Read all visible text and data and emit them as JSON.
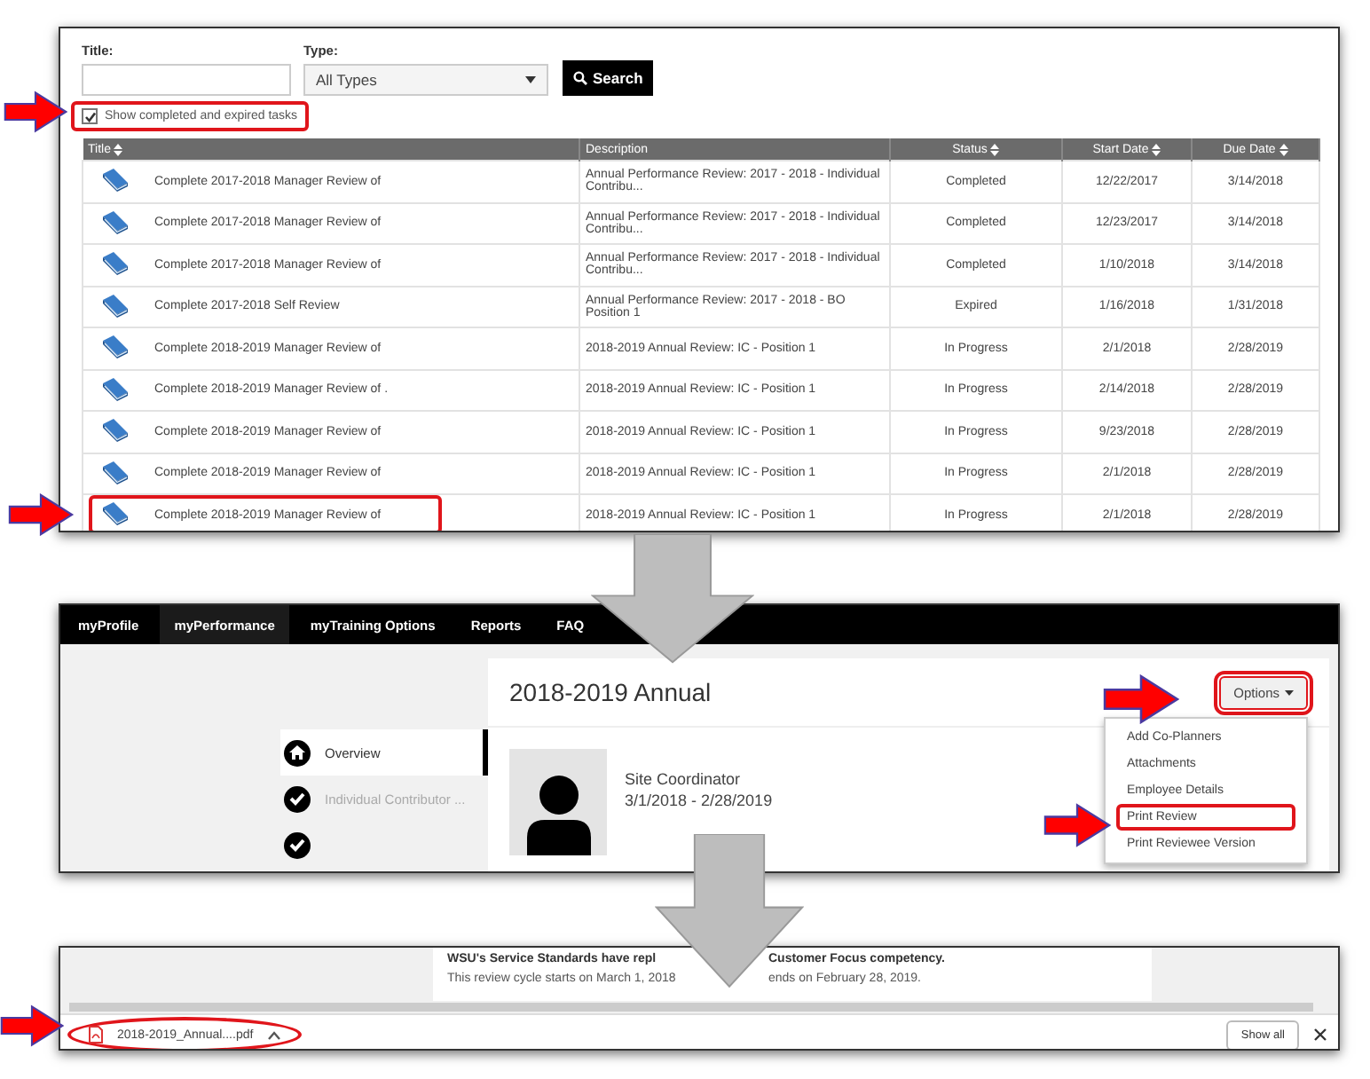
{
  "search_panel": {
    "title_label": "Title:",
    "type_label": "Type:",
    "type_select": {
      "value": "All Types"
    },
    "search_button": "Search",
    "show_completed": {
      "label": "Show completed and expired tasks",
      "checked": true,
      "highlighted": true
    },
    "table": {
      "columns": [
        {
          "label": "Title",
          "sortable": true
        },
        {
          "label": "Description",
          "sortable": false
        },
        {
          "label": "Status",
          "sortable": true
        },
        {
          "label": "Start Date",
          "sortable": true
        },
        {
          "label": "Due Date",
          "sortable": true
        }
      ],
      "rows": [
        {
          "title": "Complete 2017-2018 Manager Review of",
          "description": "Annual Performance Review: 2017 - 2018 - Individual Contribu...",
          "status": "Completed",
          "start_date": "12/22/2017",
          "due_date": "3/14/2018",
          "highlighted": false
        },
        {
          "title": "Complete 2017-2018 Manager Review of",
          "description": "Annual Performance Review: 2017 - 2018 - Individual Contribu...",
          "status": "Completed",
          "start_date": "12/23/2017",
          "due_date": "3/14/2018",
          "highlighted": false
        },
        {
          "title": "Complete 2017-2018 Manager Review of",
          "description": "Annual Performance Review: 2017 - 2018 - Individual Contribu...",
          "status": "Completed",
          "start_date": "1/10/2018",
          "due_date": "3/14/2018",
          "highlighted": false
        },
        {
          "title": "Complete 2017-2018 Self Review",
          "description": "Annual Performance Review: 2017 - 2018 - BO Position 1",
          "status": "Expired",
          "start_date": "1/16/2018",
          "due_date": "1/31/2018",
          "highlighted": false
        },
        {
          "title": "Complete 2018-2019 Manager Review of",
          "description": "2018-2019 Annual Review: IC - Position 1",
          "status": "In Progress",
          "start_date": "2/1/2018",
          "due_date": "2/28/2019",
          "highlighted": false
        },
        {
          "title": "Complete 2018-2019 Manager Review of .",
          "description": "2018-2019 Annual Review: IC - Position 1",
          "status": "In Progress",
          "start_date": "2/14/2018",
          "due_date": "2/28/2019",
          "highlighted": false
        },
        {
          "title": "Complete 2018-2019 Manager Review of",
          "description": "2018-2019 Annual Review: IC - Position 1",
          "status": "In Progress",
          "start_date": "9/23/2018",
          "due_date": "2/28/2019",
          "highlighted": false
        },
        {
          "title": "Complete 2018-2019 Manager Review of",
          "description": "2018-2019 Annual Review: IC - Position 1",
          "status": "In Progress",
          "start_date": "2/1/2018",
          "due_date": "2/28/2019",
          "highlighted": false
        },
        {
          "title": "Complete 2018-2019 Manager Review of",
          "description": "2018-2019 Annual Review: IC - Position 1",
          "status": "In Progress",
          "start_date": "2/1/2018",
          "due_date": "2/28/2019",
          "highlighted": true
        }
      ]
    }
  },
  "review_panel": {
    "nav": [
      {
        "label": "myProfile",
        "selected": false
      },
      {
        "label": "myPerformance",
        "selected": true
      },
      {
        "label": "myTraining Options",
        "selected": false
      },
      {
        "label": "Reports",
        "selected": false
      },
      {
        "label": "FAQ",
        "selected": false
      }
    ],
    "heading": "2018-2019 Annual",
    "options_button": {
      "label": "Options",
      "highlighted": true
    },
    "menu": [
      {
        "label": "Add Co-Planners",
        "highlighted": false
      },
      {
        "label": "Attachments",
        "highlighted": false
      },
      {
        "label": "Employee Details",
        "highlighted": false
      },
      {
        "label": "Print Review",
        "highlighted": true
      },
      {
        "label": "Print Reviewee Version",
        "highlighted": false
      }
    ],
    "profile": {
      "role": "Site Coordinator",
      "dates": "3/1/2018 - 2/28/2019"
    },
    "steps": [
      {
        "label": "Overview",
        "kind": "home",
        "selected": true
      },
      {
        "label": "Individual Contributor ...",
        "kind": "check",
        "selected": false
      },
      {
        "kind": "check",
        "selected": false
      }
    ]
  },
  "download_panel": {
    "page_lines": [
      {
        "kind": "bold",
        "parts": [
          "WSU's Service Standards have repl",
          "Customer Focus competency."
        ]
      },
      {
        "kind": "plain",
        "parts": [
          "This review cycle starts on March 1, 2018",
          "ends on February 28, 2019."
        ]
      }
    ],
    "download": {
      "filename": "2018-2019_Annual....pdf",
      "highlighted": true
    },
    "show_all": "Show all"
  }
}
